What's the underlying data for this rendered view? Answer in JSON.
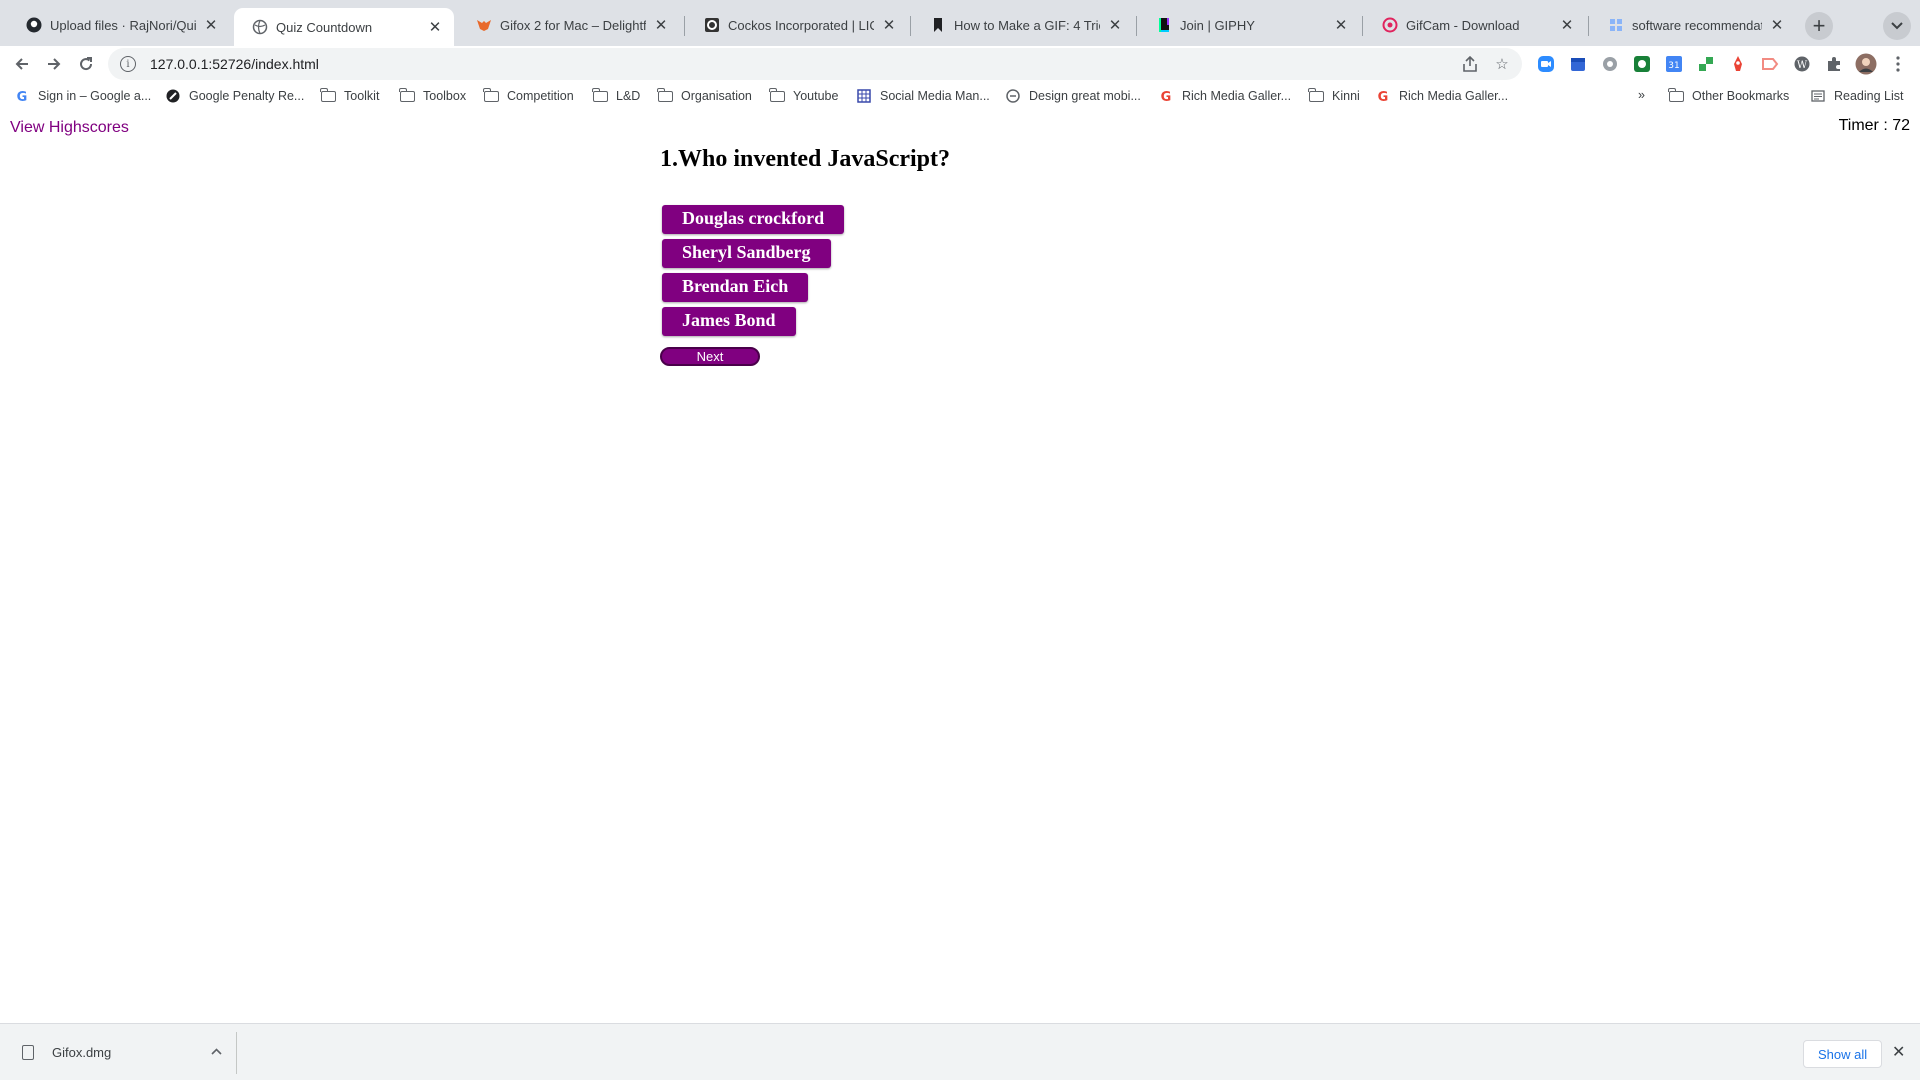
{
  "browser": {
    "tabs": [
      {
        "title": "Upload files · RajNori/QuizAp",
        "icon": "github-icon",
        "active": false
      },
      {
        "title": "Quiz Countdown",
        "icon": "globe-icon",
        "active": true
      },
      {
        "title": "Gifox 2 for Mac – Delightful",
        "icon": "fox-icon",
        "active": false
      },
      {
        "title": "Cockos Incorporated | LICEc",
        "icon": "cockos-icon",
        "active": false
      },
      {
        "title": "How to Make a GIF: 4 Tried-",
        "icon": "bookmark-icon",
        "active": false
      },
      {
        "title": "Join | GIPHY",
        "icon": "giphy-icon",
        "active": false
      },
      {
        "title": "GifCam - Download",
        "icon": "gifcam-icon",
        "active": false
      },
      {
        "title": "software recommendation -",
        "icon": "stack-icon",
        "active": false
      }
    ],
    "url": "127.0.0.1:52726/index.html",
    "bookmarks": [
      {
        "label": "Sign in – Google a...",
        "icon": "google-icon"
      },
      {
        "label": "Google Penalty Re...",
        "icon": "site-icon"
      },
      {
        "label": "Toolkit",
        "icon": "folder-icon"
      },
      {
        "label": "Toolbox",
        "icon": "folder-icon"
      },
      {
        "label": "Competition",
        "icon": "folder-icon"
      },
      {
        "label": "L&D",
        "icon": "folder-icon"
      },
      {
        "label": "Organisation",
        "icon": "folder-icon"
      },
      {
        "label": "Youtube",
        "icon": "folder-icon"
      },
      {
        "label": "Social Media Man...",
        "icon": "grid-icon"
      },
      {
        "label": "Design great mobi...",
        "icon": "site-icon"
      },
      {
        "label": "Rich Media Galler...",
        "icon": "google-icon"
      },
      {
        "label": "Kinni",
        "icon": "folder-icon"
      },
      {
        "label": "Rich Media Galler...",
        "icon": "google-icon"
      }
    ],
    "other_bookmarks": "Other Bookmarks",
    "reading_list": "Reading List",
    "overflow": "»"
  },
  "page": {
    "highscores_link": "View Highscores",
    "timer": "Timer : 72",
    "question": "1.Who invented JavaScript?",
    "answers": [
      "Douglas crockford",
      "Sheryl Sandberg",
      "Brendan Eich",
      "James Bond"
    ],
    "next_label": "Next",
    "accent_color": "#800080"
  },
  "downloads": {
    "file_name": "Gifox.dmg",
    "show_all": "Show all"
  }
}
